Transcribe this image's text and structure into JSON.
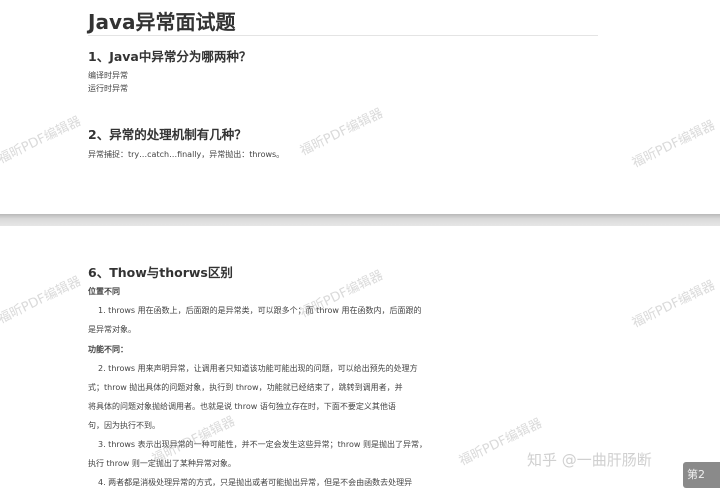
{
  "page1": {
    "title": "Java异常面试题",
    "q1": {
      "heading": "1、Java中异常分为哪两种？",
      "lines": [
        "编译时异常",
        "运行时异常"
      ]
    },
    "q2": {
      "heading": "2、异常的处理机制有几种？",
      "lines": [
        "异常捕捉：try…catch…finally，异常抛出：throws。"
      ]
    }
  },
  "page2": {
    "q6": {
      "heading": "6、Thow与thorws区别",
      "section1": "位置不同",
      "s1_lines": [
        "1. throws 用在函数上，后面跟的是异常类，可以跟多个；而 throw 用在函数内，后面跟的",
        "是异常对象。"
      ],
      "section2": "功能不同：",
      "s2_lines": [
        "2. throws 用来声明异常，让调用者只知道该功能可能出现的问题，可以给出预先的处理方",
        "式；throw 抛出具体的问题对象，执行到 throw，功能就已经结束了，跳转到调用者，并",
        "将具体的问题对象抛给调用者。也就是说 throw 语句独立存在时，下面不要定义其他语",
        "句，因为执行不到。",
        "3. throws 表示出现异常的一种可能性，并不一定会发生这些异常；throw 则是抛出了异常，",
        "执行 throw 则一定抛出了某种异常对象。",
        "4. 两者都是消极处理异常的方式，只是抛出或者可能抛出异常，但是不会由函数去处理异"
      ]
    }
  },
  "watermark_text": "福昕PDF编辑器",
  "brand_text": "知乎 @一曲肝肠断",
  "page_badge": "第2"
}
